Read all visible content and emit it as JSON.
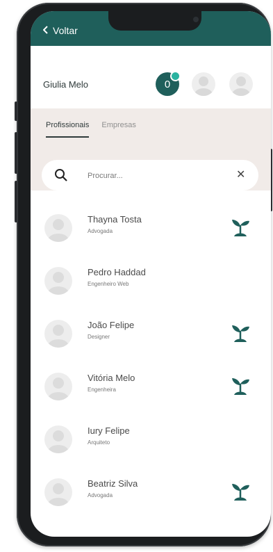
{
  "topbar": {
    "back_label": "Voltar"
  },
  "header": {
    "user_name": "Giulia Melo",
    "notification_count": "0"
  },
  "tabs": [
    {
      "label": "Profissionais"
    },
    {
      "label": "Empresas"
    }
  ],
  "search": {
    "placeholder": "Procurar..."
  },
  "list": [
    {
      "name": "Thayna Tosta",
      "role": "Advogada",
      "leaf": true
    },
    {
      "name": "Pedro Haddad",
      "role": "Engenheiro Web",
      "leaf": false
    },
    {
      "name": "João Felipe",
      "role": "Designer",
      "leaf": true
    },
    {
      "name": "Vitória Melo",
      "role": "Engenheira",
      "leaf": true
    },
    {
      "name": "Iury Felipe",
      "role": "Arquiteto",
      "leaf": false
    },
    {
      "name": "Beatriz Silva",
      "role": "Advogada",
      "leaf": true
    }
  ],
  "colors": {
    "brand": "#1f5f5b",
    "panel": "#f1ebe8"
  },
  "icons": {
    "back": "chevron-left-icon",
    "search": "search-icon",
    "clear": "close-icon",
    "leaf": "plant-sprout-icon"
  }
}
